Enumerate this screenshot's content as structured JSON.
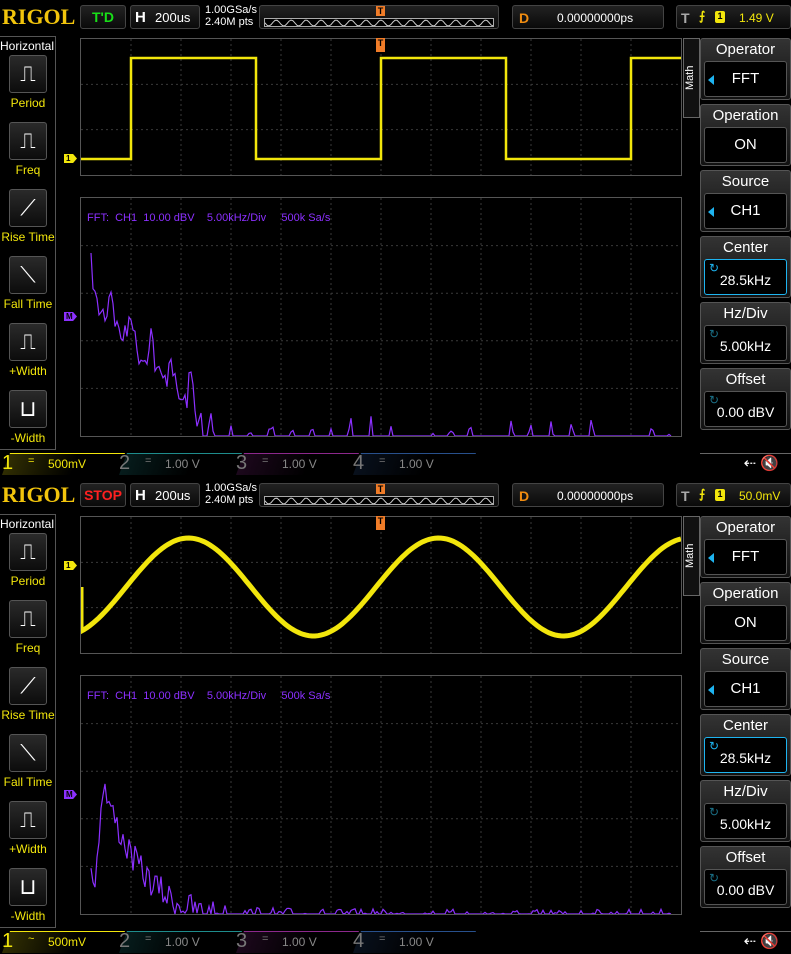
{
  "scopes": [
    {
      "logo": "RIGOL",
      "status": "T'D",
      "status_color": "#18e018",
      "horizontal": {
        "key": "H",
        "timebase": "200us"
      },
      "sample_rate": "1.00GSa/s",
      "memory_depth": "2.40M pts",
      "trigger_marker": "T",
      "delay": {
        "key": "D",
        "value": "0.00000000ps"
      },
      "trigger": {
        "key": "T",
        "edge": "rising",
        "source": "1",
        "level": "1.49 V"
      },
      "left_menu": {
        "title": "Horizontal",
        "items": [
          "Period",
          "Freq",
          "Rise Time",
          "Fall Time",
          "+Width",
          "-Width"
        ]
      },
      "waveform": {
        "type": "square",
        "channel_marker": "1"
      },
      "fft": {
        "marker": "M",
        "label": "FFT:  CH1  10.00 dBV    5.00kHz/Div     500k Sa/s",
        "shape": "square-harmonics"
      },
      "math_tab": "Math",
      "right_menu": [
        {
          "title": "Operator",
          "value": "FFT",
          "kind": "arrow"
        },
        {
          "title": "Operation",
          "value": "ON",
          "kind": "plain"
        },
        {
          "title": "Source",
          "value": "CH1",
          "kind": "arrow"
        },
        {
          "title": "Center",
          "value": "28.5kHz",
          "kind": "knob-active"
        },
        {
          "title": "Hz/Div",
          "value": "5.00kHz",
          "kind": "knob"
        },
        {
          "title": "Offset",
          "value": "0.00 dBV",
          "kind": "knob"
        }
      ],
      "channels": [
        {
          "num": "1",
          "coupling": "=",
          "scale": "500mV",
          "color": "#f2e60c",
          "active": true
        },
        {
          "num": "2",
          "coupling": "=",
          "scale": "1.00 V",
          "color": "#1e8c8c",
          "active": false
        },
        {
          "num": "3",
          "coupling": "=",
          "scale": "1.00 V",
          "color": "#8c288c",
          "active": false
        },
        {
          "num": "4",
          "coupling": "=",
          "scale": "1.00 V",
          "color": "#28508c",
          "active": false
        }
      ],
      "status_icons": "⇠ 🔇"
    },
    {
      "logo": "RIGOL",
      "status": "STOP",
      "status_color": "#ff2020",
      "horizontal": {
        "key": "H",
        "timebase": "200us"
      },
      "sample_rate": "1.00GSa/s",
      "memory_depth": "2.40M pts",
      "trigger_marker": "T",
      "delay": {
        "key": "D",
        "value": "0.00000000ps"
      },
      "trigger": {
        "key": "T",
        "edge": "rising",
        "source": "1",
        "level": "50.0mV"
      },
      "left_menu": {
        "title": "Horizontal",
        "items": [
          "Period",
          "Freq",
          "Rise Time",
          "Fall Time",
          "+Width",
          "-Width"
        ]
      },
      "waveform": {
        "type": "sine",
        "channel_marker": "1"
      },
      "fft": {
        "marker": "M",
        "label": "FFT:  CH1  10.00 dBV    5.00kHz/Div     500k Sa/s",
        "shape": "sine-peak"
      },
      "math_tab": "Math",
      "right_menu": [
        {
          "title": "Operator",
          "value": "FFT",
          "kind": "arrow"
        },
        {
          "title": "Operation",
          "value": "ON",
          "kind": "plain"
        },
        {
          "title": "Source",
          "value": "CH1",
          "kind": "arrow"
        },
        {
          "title": "Center",
          "value": "28.5kHz",
          "kind": "knob-active"
        },
        {
          "title": "Hz/Div",
          "value": "5.00kHz",
          "kind": "knob"
        },
        {
          "title": "Offset",
          "value": "0.00 dBV",
          "kind": "knob"
        }
      ],
      "channels": [
        {
          "num": "1",
          "coupling": "~",
          "scale": "500mV",
          "color": "#f2e60c",
          "active": true
        },
        {
          "num": "2",
          "coupling": "=",
          "scale": "1.00 V",
          "color": "#1e8c8c",
          "active": false
        },
        {
          "num": "3",
          "coupling": "=",
          "scale": "1.00 V",
          "color": "#8c288c",
          "active": false
        },
        {
          "num": "4",
          "coupling": "=",
          "scale": "1.00 V",
          "color": "#28508c",
          "active": false
        }
      ],
      "status_icons": "⇠ 🔇"
    }
  ]
}
